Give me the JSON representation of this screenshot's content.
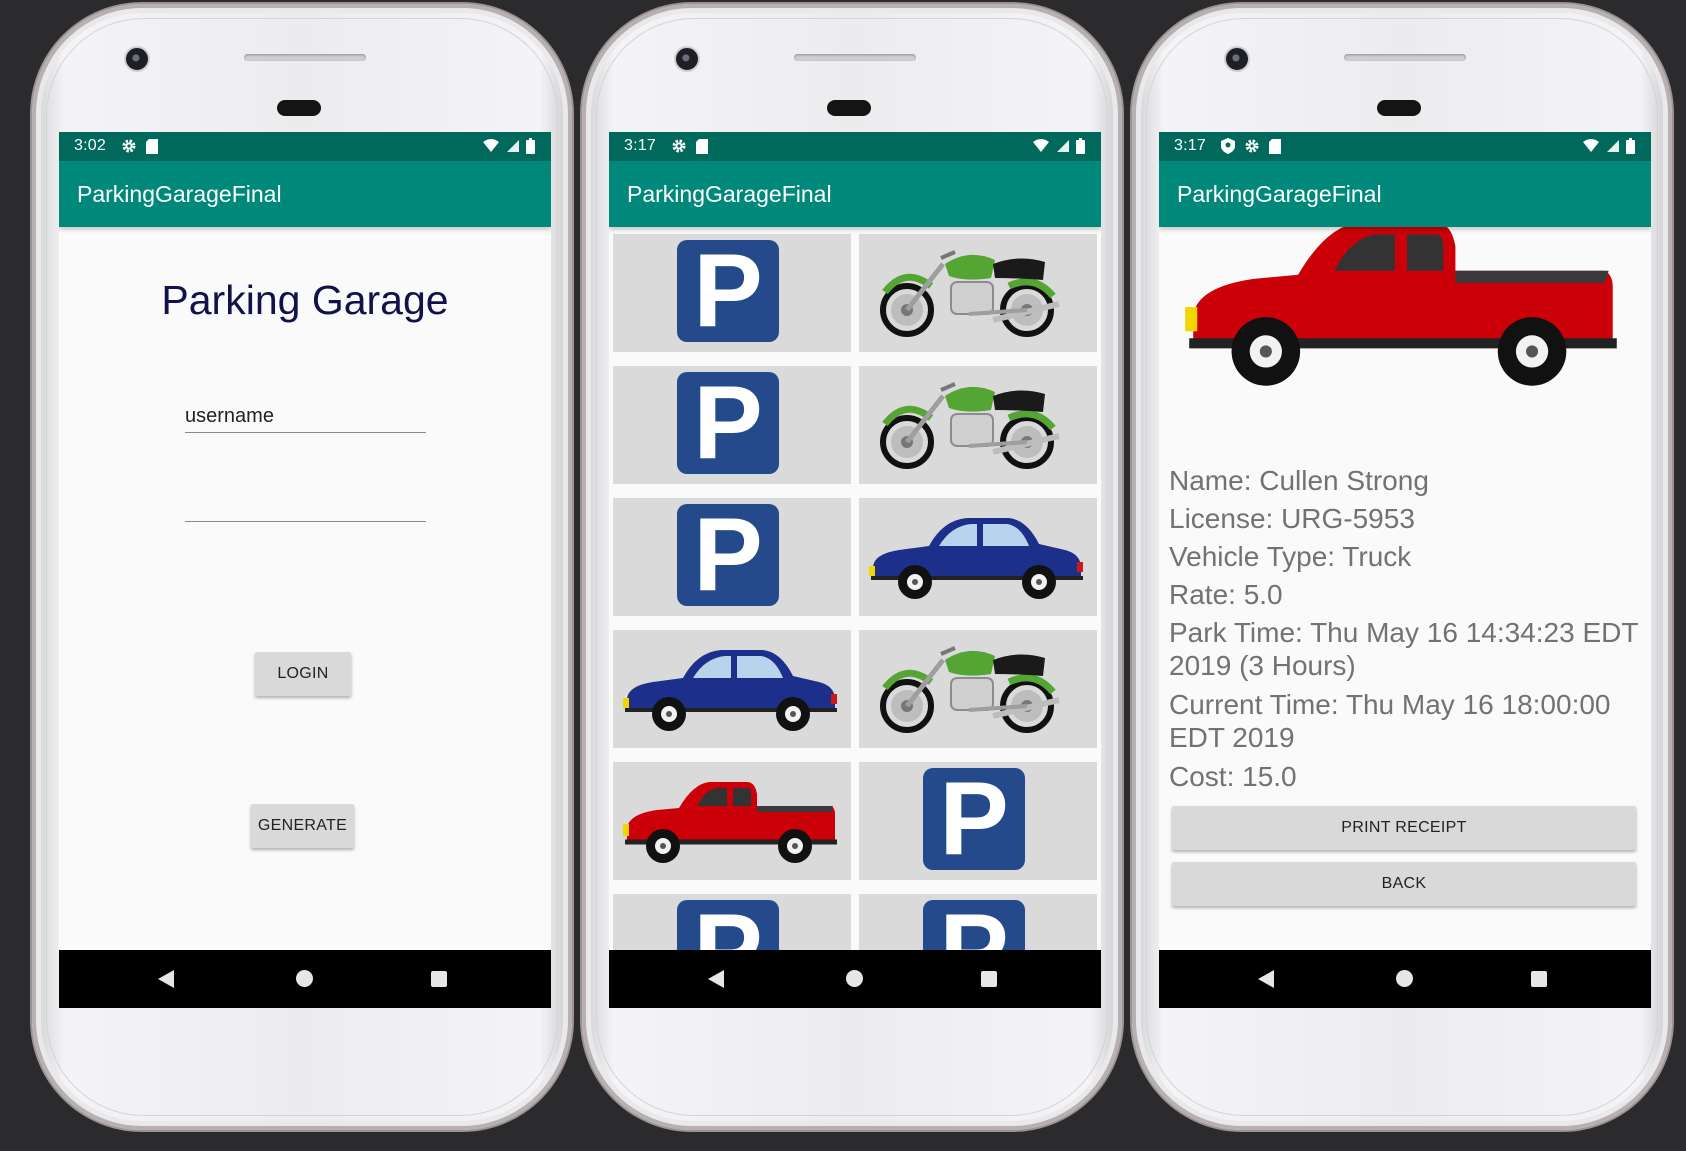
{
  "colors": {
    "status_bar": "#00695c",
    "app_bar": "#00897b",
    "heading": "#12124a",
    "parking_sign": "#244a8c",
    "car_blue": "#1c2f8a",
    "truck_red": "#cc0008",
    "moto_green": "#55a534"
  },
  "screens": [
    {
      "status_time": "3:02",
      "app_title": "ParkingGarageFinal",
      "heading": "Parking Garage",
      "username_placeholder": "username",
      "password_value": "",
      "login_label": "LOGIN",
      "generate_label": "GENERATE"
    },
    {
      "status_time": "3:17",
      "app_title": "ParkingGarageFinal",
      "spots": [
        "parking-sign",
        "motorcycle",
        "parking-sign",
        "motorcycle",
        "parking-sign",
        "car",
        "car",
        "motorcycle",
        "truck",
        "parking-sign",
        "parking-sign",
        "parking-sign"
      ]
    },
    {
      "status_time": "3:17",
      "app_title": "ParkingGarageFinal",
      "vehicle_image": "truck",
      "name": "Name: Cullen Strong",
      "license": "License: URG-5953",
      "vehicle_type": "Vehicle Type: Truck",
      "rate": "Rate: 5.0",
      "park_time": "Park Time: Thu May 16 14:34:23 EDT 2019 (3 Hours)",
      "current_time": "Current Time: Thu May 16 18:00:00 EDT 2019",
      "cost": "Cost: 15.0",
      "print_receipt_label": "PRINT RECEIPT",
      "back_label": "BACK"
    }
  ]
}
